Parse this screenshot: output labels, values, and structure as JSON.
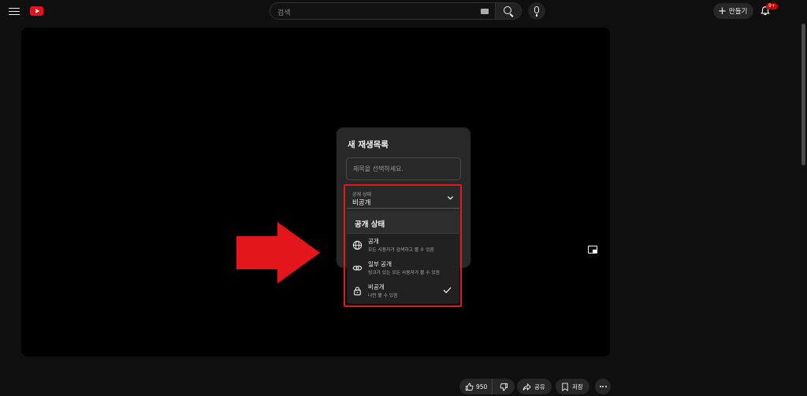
{
  "header": {
    "search": {
      "placeholder": "검색"
    },
    "create_label": "만들기",
    "notification_badge": "9+"
  },
  "dialog": {
    "title": "새 재생목록",
    "title_placeholder": "제목을 선택하세요.",
    "visibility": {
      "label": "공개 상태",
      "selected": "비공개"
    },
    "menu": {
      "header": "공개 상태",
      "items": [
        {
          "title": "공개",
          "description": "모든 사용자가 검색하고 볼 수 있음",
          "icon": "globe-icon",
          "selected": false
        },
        {
          "title": "일부 공개",
          "description": "링크가 있는 모든 사용자가 볼 수 있음",
          "icon": "link-icon",
          "selected": false
        },
        {
          "title": "비공개",
          "description": "나만 볼 수 있음",
          "icon": "lock-icon",
          "selected": true
        }
      ]
    }
  },
  "actions": {
    "like_count": "950",
    "share_label": "공유",
    "save_label": "저장"
  },
  "colors": {
    "background": "#0f0f0f",
    "accent_red": "#e01919",
    "brand_red": "#e3121b"
  }
}
